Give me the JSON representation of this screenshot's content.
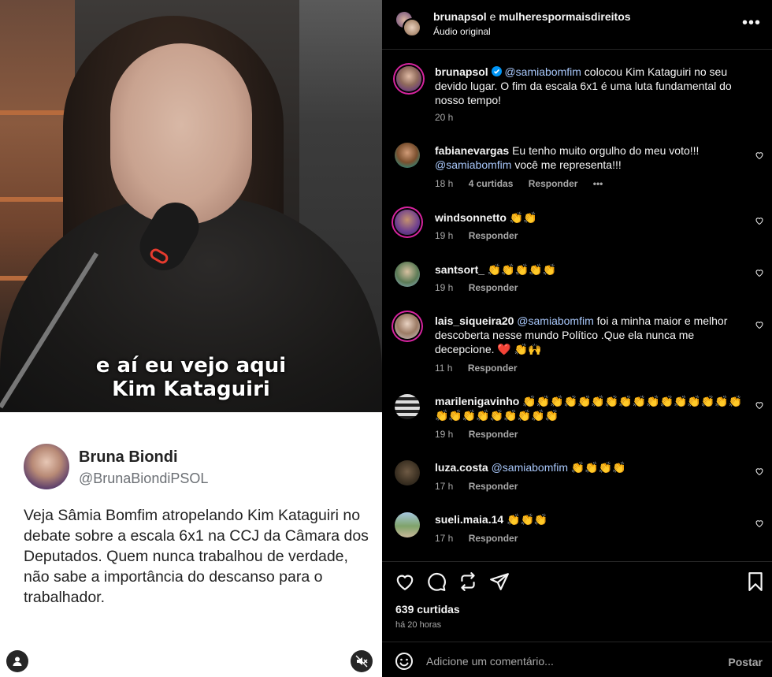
{
  "media": {
    "caption_line1": "e aí eu vejo aqui",
    "caption_line2": "Kim Kataguiri",
    "tweet": {
      "name": "Bruna Biondi",
      "handle": "@BrunaBiondiPSOL",
      "text": "Veja Sâmia Bomfim atropelando Kim Kataguiri no debate sobre a escala 6x1 na CCJ da Câmara dos Deputados. Quem nunca trabalhou de verdade, não sabe a importância do descanso para o trabalhador."
    },
    "user_icon": "user-tag-icon",
    "mute_icon": "muted-speaker-icon"
  },
  "header": {
    "user1": "brunapsol",
    "connector": "e",
    "user2": "mulherespormaisdireitos",
    "audio": "Áudio original",
    "more_icon": "more-options-icon"
  },
  "caption": {
    "username": "brunapsol",
    "mention": "@samiabomfim",
    "text": " colocou Kim Kataguiri no seu devido lugar. O fim da escala 6x1 é uma luta fundamental do nosso tempo!",
    "time": "20 h"
  },
  "comments": [
    {
      "username": "fabianevargas",
      "mention": "",
      "text": "Eu tenho muito orgulho do meu voto!!!",
      "text2_mention": "@samiabomfim",
      "text2": " você me representa!!!",
      "time": "18 h",
      "likes": "4 curtidas",
      "reply": "Responder",
      "more": "•••"
    },
    {
      "username": "windsonnetto",
      "mention": "",
      "text": "👏👏",
      "time": "19 h",
      "reply": "Responder"
    },
    {
      "username": "santsort_",
      "mention": "",
      "text": "👏👏👏👏👏",
      "time": "19 h",
      "reply": "Responder"
    },
    {
      "username": "lais_siqueira20",
      "mention": "@samiabomfim",
      "text": " foi a minha maior e melhor descoberta nesse mundo Político .Que ela nunca me decepcione. ❤️ 👏🙌",
      "time": "11 h",
      "reply": "Responder"
    },
    {
      "username": "marilenigavinho",
      "mention": "",
      "text": "👏👏👏👏👏👏👏👏👏👏👏👏👏👏👏👏👏👏👏👏👏👏👏👏👏",
      "time": "19 h",
      "reply": "Responder"
    },
    {
      "username": "luza.costa",
      "mention": "@samiabomfim",
      "text": " 👏👏👏👏",
      "time": "17 h",
      "reply": "Responder"
    },
    {
      "username": "sueli.maia.14",
      "mention": "",
      "text": "👏👏👏",
      "time": "17 h",
      "reply": "Responder"
    }
  ],
  "actions": {
    "like_icon": "heart-icon",
    "comment_icon": "comment-icon",
    "repost_icon": "repost-icon",
    "share_icon": "send-icon",
    "save_icon": "bookmark-icon",
    "likes": "639 curtidas",
    "ago": "há 20 horas"
  },
  "composer": {
    "emoji_icon": "emoji-icon",
    "placeholder": "Adicione um comentário...",
    "post_label": "Postar"
  },
  "colors": {
    "background": "#000000",
    "text": "#f5f5f5",
    "secondary": "#a8a8a8",
    "mention": "#a8c7fa",
    "verified": "#0095f6"
  }
}
